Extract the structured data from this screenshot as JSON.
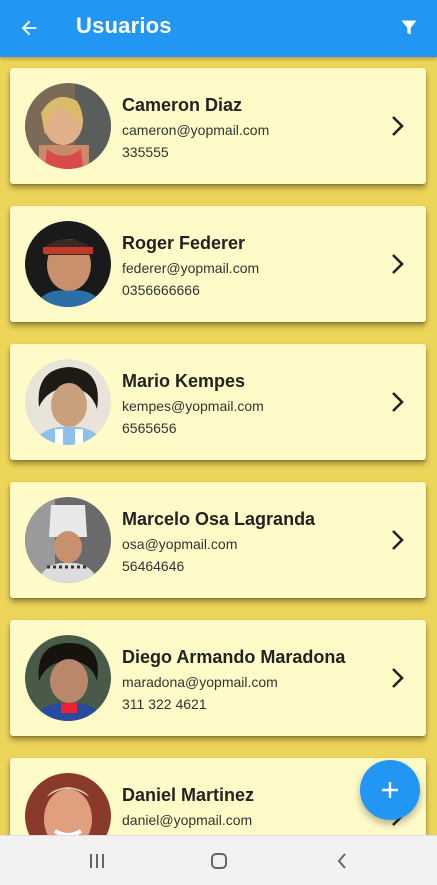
{
  "appbar": {
    "title": "Usuarios",
    "back_icon": "arrow-left-icon",
    "filter_icon": "filter-icon",
    "color": "#2196F3"
  },
  "users": [
    {
      "name": "Cameron Diaz",
      "email": "cameron@yopmail.com",
      "phone": "335555"
    },
    {
      "name": "Roger Federer",
      "email": "federer@yopmail.com",
      "phone": "0356666666"
    },
    {
      "name": "Mario Kempes",
      "email": "kempes@yopmail.com",
      "phone": "6565656"
    },
    {
      "name": "Marcelo Osa Lagranda",
      "email": "osa@yopmail.com",
      "phone": "56464646"
    },
    {
      "name": "Diego Armando  Maradona",
      "email": "maradona@yopmail.com",
      "phone": "311 322 4621"
    },
    {
      "name": "Daniel Martinez",
      "email": "daniel@yopmail.com",
      "phone": ""
    }
  ],
  "fab": {
    "icon": "plus-icon"
  },
  "navbar": {
    "recent_icon": "recent-apps-icon",
    "home_icon": "home-icon",
    "back_icon": "nav-back-icon"
  },
  "colors": {
    "background": "#EDD55A",
    "card": "#FFFBC8",
    "accent": "#2196F3"
  }
}
